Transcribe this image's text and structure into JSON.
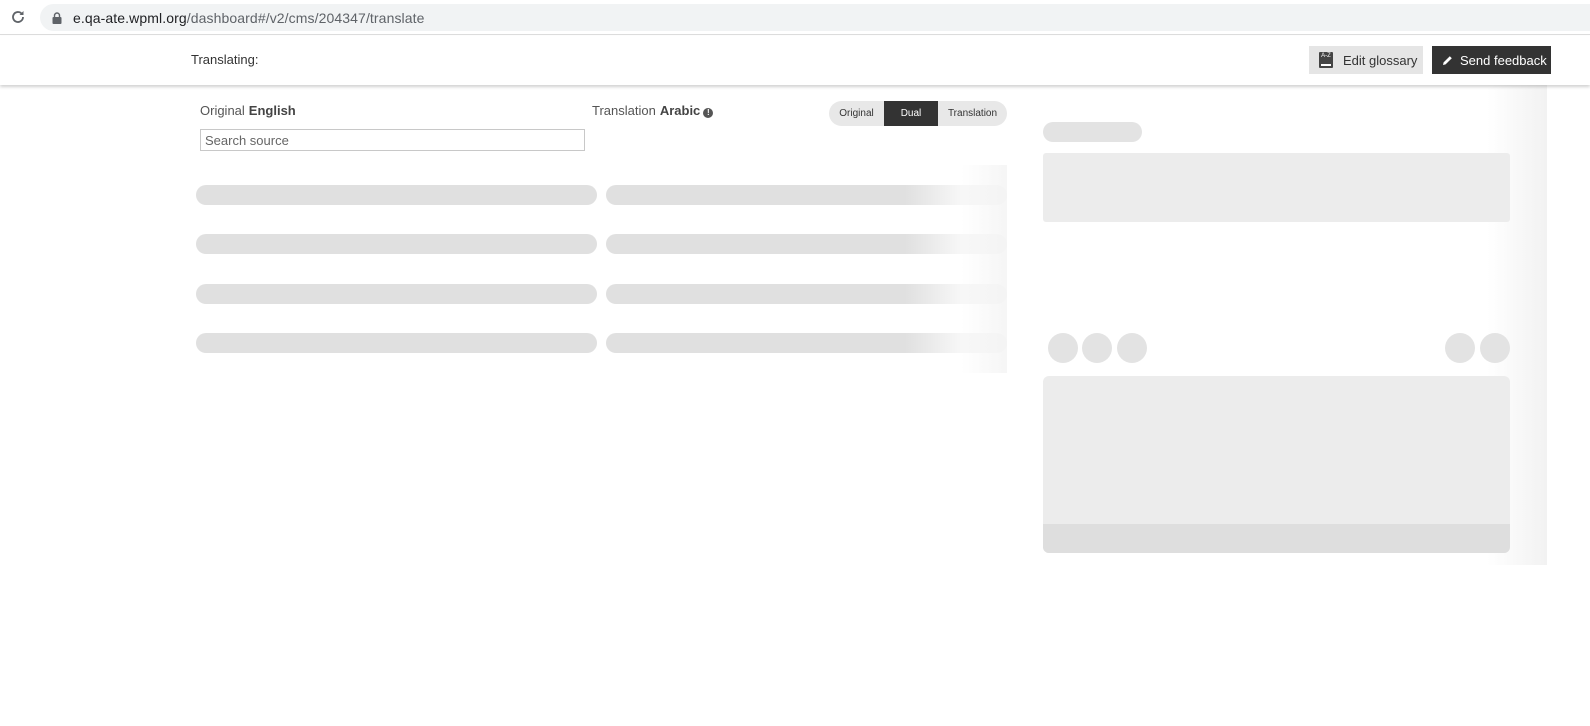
{
  "browser": {
    "url_host": "e.qa-ate.wpml.org",
    "url_path": "/dashboard#/v2/cms/204347/translate"
  },
  "header": {
    "translating_label": "Translating:",
    "edit_glossary_label": "Edit glossary",
    "glossary_icon_text": "A-Z",
    "send_feedback_label": "Send feedback"
  },
  "editor": {
    "original_label": "Original",
    "original_language": "English",
    "translation_label": "Translation",
    "translation_language": "Arabic",
    "search_placeholder": "Search source",
    "view_modes": {
      "original": "Original",
      "dual": "Dual",
      "translation": "Translation",
      "selected": "Dual"
    }
  },
  "colors": {
    "dark_button": "#333333",
    "skeleton": "#e0e0e0",
    "skeleton_light": "#ececec"
  },
  "icons": {
    "reload": "reload-icon",
    "lock": "lock-icon",
    "glossary": "glossary-book-icon",
    "feedback": "pencil-icon",
    "info": "info-icon"
  }
}
